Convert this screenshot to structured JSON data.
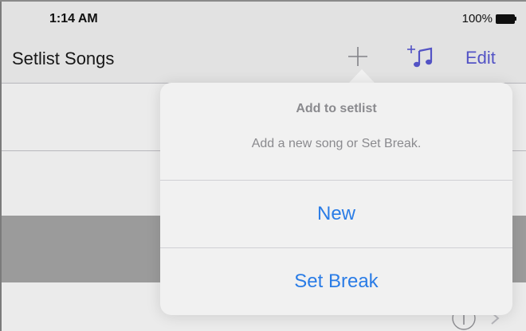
{
  "status_bar": {
    "time": "1:14 AM",
    "battery_percent": "100%"
  },
  "nav": {
    "title": "Setlist Songs",
    "add_icon": "plus-icon",
    "add_music_icon": "add-music-note-icon",
    "edit_label": "Edit"
  },
  "popover": {
    "title": "Add to setlist",
    "message": "Add a new song or Set Break.",
    "actions": [
      {
        "label": "New"
      },
      {
        "label": "Set Break"
      }
    ]
  },
  "colors": {
    "accent_purple": "#5b5bd6",
    "action_blue": "#2a7ce6",
    "selected_row": "#a9a9a9"
  }
}
